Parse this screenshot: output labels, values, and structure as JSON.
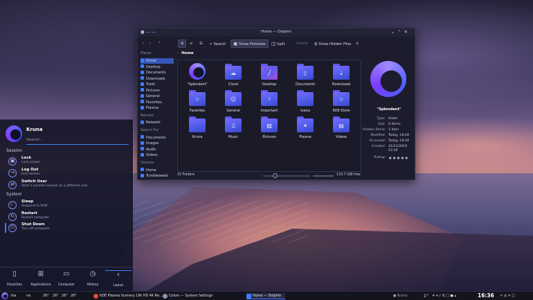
{
  "colors": {
    "accent": "#3f7dff",
    "folder": "#5b5fef",
    "panel": "#161628",
    "window_bg": "#1c1c2c"
  },
  "launcher": {
    "username": "Kruna",
    "search_placeholder": "Search...",
    "sections": [
      {
        "title": "Session",
        "items": [
          {
            "title": "Lock",
            "subtitle": "Lock screen",
            "icon": "lock-icon"
          },
          {
            "title": "Log Out",
            "subtitle": "End session",
            "icon": "logout-icon"
          },
          {
            "title": "Switch User",
            "subtitle": "Start a parallel session as a different user",
            "icon": "switch-user-icon"
          }
        ]
      },
      {
        "title": "System",
        "items": [
          {
            "title": "Sleep",
            "subtitle": "Suspend to RAM",
            "icon": "sleep-icon"
          },
          {
            "title": "Restart",
            "subtitle": "Restart computer",
            "icon": "restart-icon"
          },
          {
            "title": "Shut Down",
            "subtitle": "Turn off computer",
            "icon": "power-icon"
          }
        ]
      }
    ],
    "tabs": [
      {
        "label": "Favorites",
        "icon": "bookmark-icon"
      },
      {
        "label": "Applications",
        "icon": "grid-icon"
      },
      {
        "label": "Computer",
        "icon": "monitor-icon"
      },
      {
        "label": "History",
        "icon": "clock-icon"
      },
      {
        "label": "Leave",
        "icon": "leave-icon"
      }
    ]
  },
  "dolphin": {
    "title": "Home — Dolphin",
    "toolbar": {
      "search": "Search",
      "show_previews": "Show Previews",
      "split": "Split",
      "delete": "Delete",
      "show_hidden": "Show Hidden Files"
    },
    "places": {
      "header": "Places",
      "items": [
        "Home",
        "Desktop",
        "Documents",
        "Downloads",
        "Trash",
        "Pictures",
        "General",
        "Favorites",
        "Plasma"
      ],
      "remote_header": "Remote",
      "remote_items": [
        "Network"
      ],
      "search_header": "Search For",
      "search_items": [
        "Documents",
        "Images",
        "Audio",
        "Videos"
      ],
      "devices_header": "Devices",
      "device_items": [
        "Home",
        "Tumbleweed"
      ]
    },
    "breadcrumb": "Home",
    "files": [
      {
        "name": "\"Splendent\"",
        "icon": "splendent-icon"
      },
      {
        "name": "Cloud",
        "icon": "cloud-icon"
      },
      {
        "name": "Desktop",
        "icon": "desktop-icon"
      },
      {
        "name": "Documents",
        "icon": "document-icon"
      },
      {
        "name": "Downloads",
        "icon": "download-icon"
      },
      {
        "name": "Favorites",
        "icon": "star-icon"
      },
      {
        "name": "General",
        "icon": "person-icon"
      },
      {
        "name": "Important",
        "icon": "exclamation-icon"
      },
      {
        "name": "Ivana",
        "icon": "folder-icon"
      },
      {
        "name": "KDE-Store",
        "icon": "kde-store-icon"
      },
      {
        "name": "Kruna",
        "icon": "folder-icon"
      },
      {
        "name": "Music",
        "icon": "music-icon"
      },
      {
        "name": "Pictures",
        "icon": "image-icon"
      },
      {
        "name": "Plasma",
        "icon": "plasma-icon"
      },
      {
        "name": "Videos",
        "icon": "video-icon"
      }
    ],
    "status_left": "15 Folders",
    "status_free": "133.7 GiB free",
    "info": {
      "name": "\"Splendent\"",
      "rows": [
        {
          "k": "Type:",
          "v": "folder"
        },
        {
          "k": "Size:",
          "v": "0 items"
        },
        {
          "k": "Hidden items:",
          "v": "1 item"
        },
        {
          "k": "Modified:",
          "v": "Today, 14:24"
        },
        {
          "k": "Accessed:",
          "v": "Today, 14:24"
        },
        {
          "k": "Created:",
          "v": "21/11/2019"
        },
        {
          "k": "",
          "v": "23:39"
        },
        {
          "k": "Rating:",
          "v": ""
        }
      ],
      "rating_stars": "★★★★★"
    }
  },
  "taskbar": {
    "items": [
      "fsa",
      "na",
      "26°",
      "26°",
      "26°",
      "26°"
    ],
    "tasks": [
      {
        "label": "KDE Plasma Scenery 19k HD 4K Re...",
        "kind": "browser"
      },
      {
        "label": "Colors — System Settings",
        "kind": "settings"
      },
      {
        "label": "Home — Dolphin",
        "kind": "dolphin"
      }
    ],
    "user": "Kruna",
    "temp": "1°",
    "clock": "16:36"
  }
}
